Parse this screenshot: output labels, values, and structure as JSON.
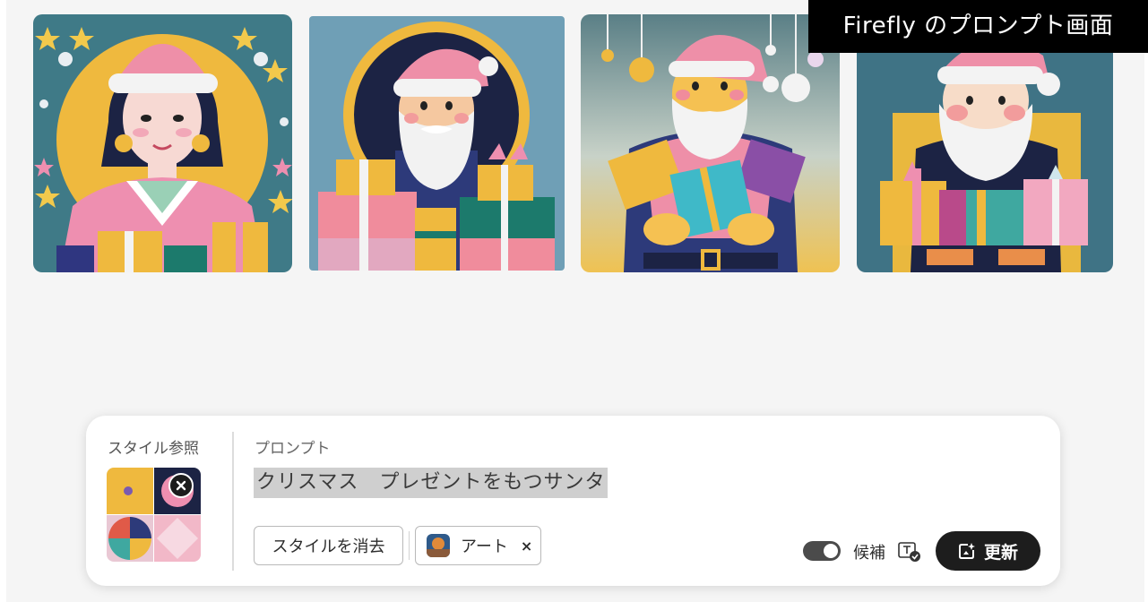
{
  "caption": "Firefly のプロンプト画面",
  "gallery": {
    "images": [
      {
        "name": "generated-image-1"
      },
      {
        "name": "generated-image-2"
      },
      {
        "name": "generated-image-3"
      },
      {
        "name": "generated-image-4"
      }
    ]
  },
  "style_reference": {
    "label": "スタイル参照",
    "remove_icon": "close-icon"
  },
  "prompt": {
    "label": "プロンプト",
    "value": "クリスマス　プレゼントをもつサンタ"
  },
  "buttons": {
    "clear_style": "スタイルを消去",
    "art_chip": "アート",
    "art_chip_close": "×",
    "update": "更新"
  },
  "toggle": {
    "label": "候補",
    "state": "on"
  },
  "colors": {
    "accent_dark": "#1d1d1d",
    "background": "#f5f5f5",
    "selection": "#cfcfcf"
  }
}
